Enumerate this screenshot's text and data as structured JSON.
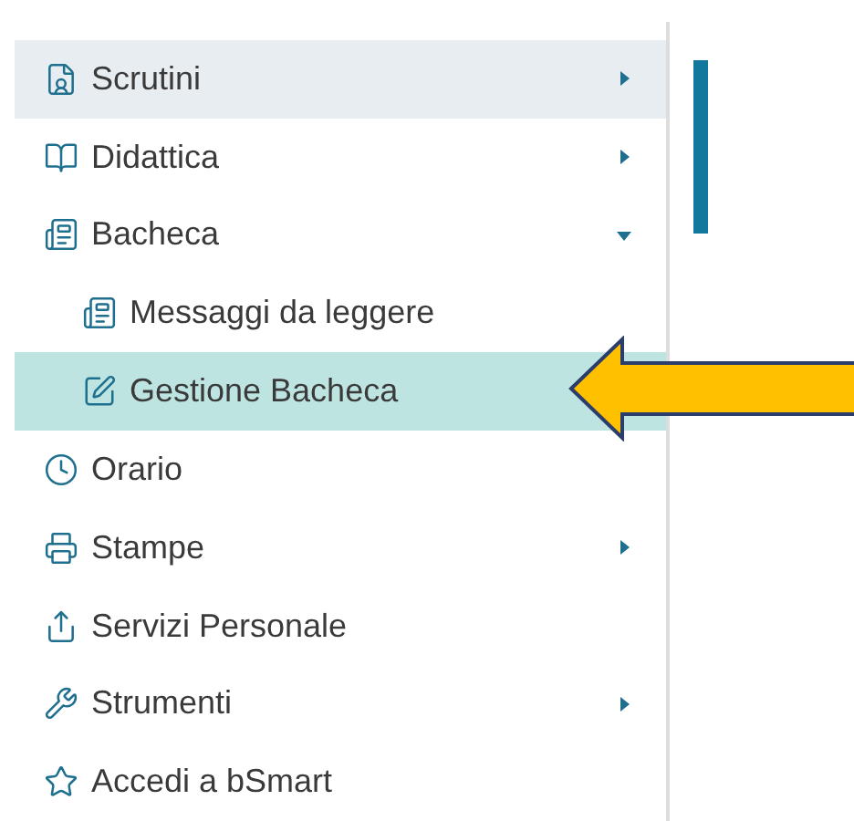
{
  "menu": [
    {
      "label": "Scrutini",
      "kind": "submenu",
      "expanded": false,
      "highlighted": true,
      "selected": false
    },
    {
      "label": "Didattica",
      "kind": "submenu",
      "expanded": false,
      "highlighted": false,
      "selected": false
    },
    {
      "label": "Bacheca",
      "kind": "submenu",
      "expanded": true,
      "highlighted": false,
      "selected": false,
      "children": [
        {
          "label": "Messaggi da leggere",
          "selected": false
        },
        {
          "label": "Gestione Bacheca",
          "selected": true
        }
      ]
    },
    {
      "label": "Orario",
      "kind": "link",
      "highlighted": false,
      "selected": false
    },
    {
      "label": "Stampe",
      "kind": "submenu",
      "expanded": false,
      "highlighted": false,
      "selected": false
    },
    {
      "label": "Servizi Personale",
      "kind": "link",
      "highlighted": false,
      "selected": false
    },
    {
      "label": "Strumenti",
      "kind": "submenu",
      "expanded": false,
      "highlighted": false,
      "selected": false
    },
    {
      "label": "Accedi a bSmart",
      "kind": "link",
      "highlighted": false,
      "selected": false
    }
  ]
}
